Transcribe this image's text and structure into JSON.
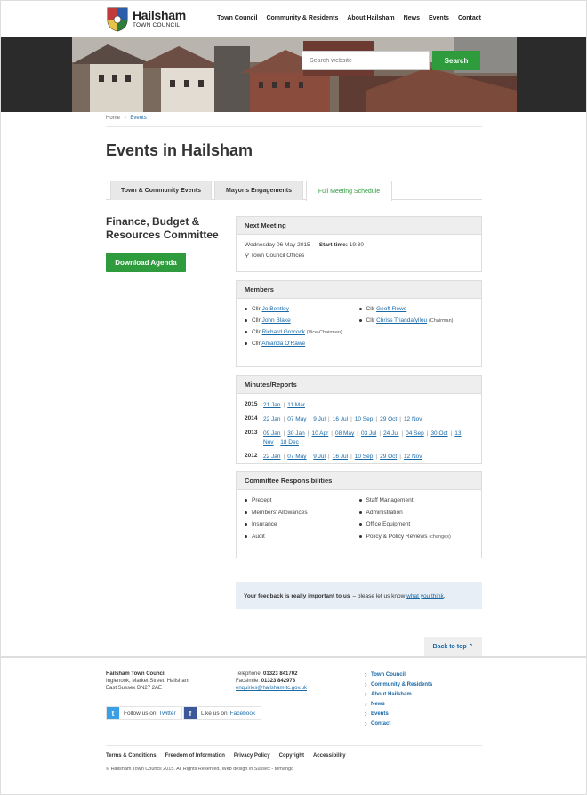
{
  "header": {
    "logo_name": "Hailsham",
    "logo_sub": "TOWN COUNCIL",
    "nav": [
      "Town Council",
      "Community & Residents",
      "About Hailsham",
      "News",
      "Events",
      "Contact"
    ]
  },
  "search": {
    "placeholder": "Search website",
    "button": "Search"
  },
  "breadcrumb": {
    "home": "Home",
    "separator": "›",
    "current": "Events"
  },
  "page_title": "Events in Hailsham",
  "tabs": [
    {
      "label": "Town & Community Events"
    },
    {
      "label": "Mayor's Engagements"
    },
    {
      "label": "Full Meeting Schedule"
    }
  ],
  "committee": {
    "title": "Finance, Budget & Resources Committee",
    "download_label": "Download Agenda"
  },
  "next_meeting": {
    "heading": "Next Meeting",
    "date": "Wednesday 06 May 2015",
    "dash": "—",
    "start_label": "Start time:",
    "start_time": "19:30",
    "location": "Town Council Offices"
  },
  "members": {
    "heading": "Members",
    "prefix": "Cllr",
    "left": [
      {
        "name": "Jo Bentley",
        "role": ""
      },
      {
        "name": "John Blake",
        "role": ""
      },
      {
        "name": "Richard Grocock",
        "role": "(Vice-Chairman)"
      },
      {
        "name": "Amanda O'Rawe",
        "role": ""
      }
    ],
    "right": [
      {
        "name": "Geoff Rowe",
        "role": ""
      },
      {
        "name": "Chriss Triandafyllou",
        "role": "(Chairman)"
      }
    ]
  },
  "minutes": {
    "heading": "Minutes/Reports",
    "years": [
      {
        "year": "2015",
        "dates": [
          "21 Jan",
          "11 Mar"
        ]
      },
      {
        "year": "2014",
        "dates": [
          "22 Jan",
          "07 May",
          "9 Jul",
          "16 Jul",
          "10 Sep",
          "29 Oct",
          "12 Nov"
        ]
      },
      {
        "year": "2013",
        "dates": [
          "09 Jan",
          "30 Jan",
          "10 Apr",
          "08 May",
          "03 Jul",
          "24 Jul",
          "04 Sep",
          "30 Oct",
          "13 Nov",
          "18 Dec"
        ]
      },
      {
        "year": "2012",
        "dates": [
          "22 Jan",
          "07 May",
          "9 Jul",
          "16 Jul",
          "10 Sep",
          "29 Oct",
          "12 Nov"
        ]
      }
    ]
  },
  "responsibilities": {
    "heading": "Committee Responsibilities",
    "left": [
      "Precept",
      "Members' Allowances",
      "Insurance",
      "Audit"
    ],
    "right": [
      "Staff Management",
      "Administration",
      "Office Equipment",
      "Policy & Policy Reviews"
    ],
    "right_note": "(changes)"
  },
  "feedback": {
    "bold": "Your feedback is really important to us",
    "text": "– please let us know",
    "link": "what you think",
    "end": "."
  },
  "back_to_top": "Back to top ⌃",
  "footer": {
    "org": "Hailsham Town Council",
    "addr1": "Inglenook, Market Street, Hailsham",
    "addr2": "East Sussex BN27 2AE",
    "tel_label": "Telephone:",
    "tel": "01323 841702",
    "fax_label": "Facsimile:",
    "fax": "01323 842978",
    "email": "enquiries@hailsham-tc.gov.uk",
    "links": [
      "Town Council",
      "Community & Residents",
      "About Hailsham",
      "News",
      "Events",
      "Contact"
    ],
    "twitter_text": "Follow us on",
    "twitter_link": "Twitter",
    "facebook_text": "Like us on",
    "facebook_link": "Facebook",
    "legal": [
      "Terms & Conditions",
      "Freedom of Information",
      "Privacy Policy",
      "Copyright",
      "Accessibility"
    ],
    "copyright": "© Hailsham Town Council 2015. All Rights Reserved.  Web design in Sussex - tomango"
  },
  "colors": {
    "accent": "#2e9b3d",
    "link": "#1a6aa8",
    "hero_bg": "#2b2b2b"
  }
}
